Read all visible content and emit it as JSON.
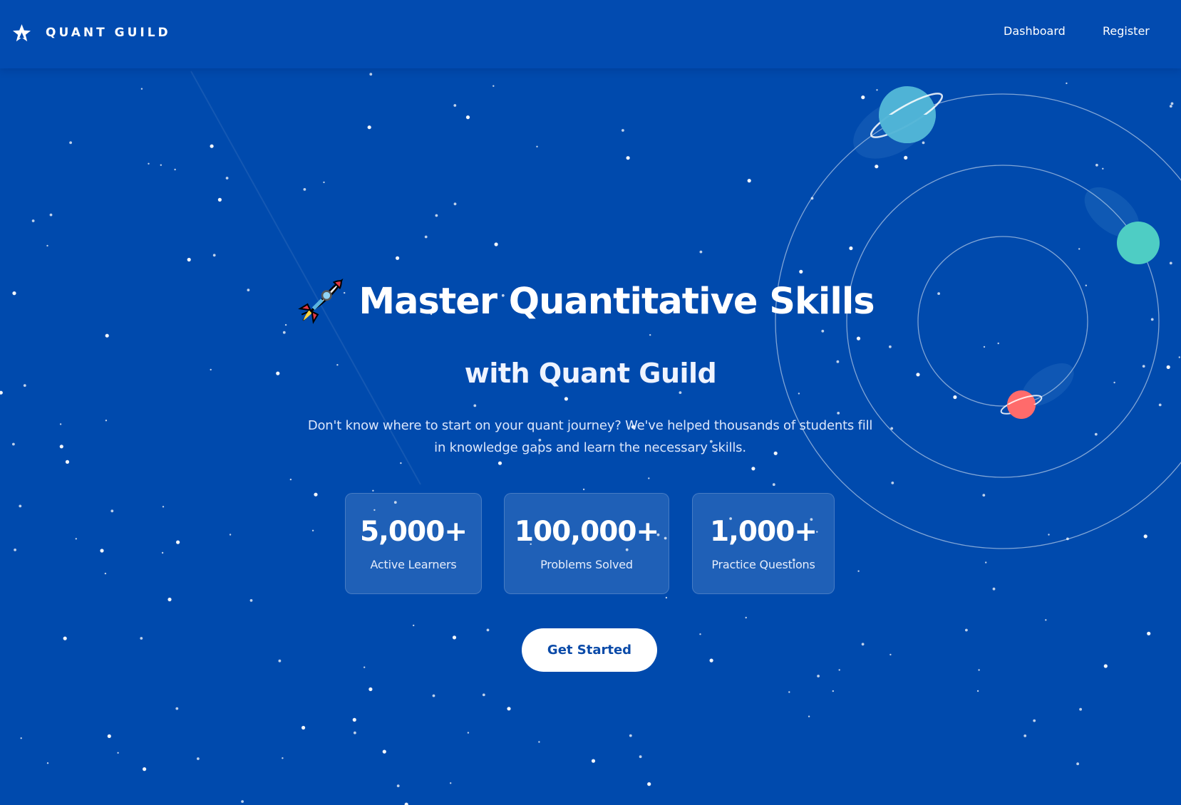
{
  "header": {
    "brand_name": "QUANT GUILD",
    "logo_icon": "star-logo-icon",
    "nav": [
      {
        "label": "Dashboard"
      },
      {
        "label": "Register"
      }
    ]
  },
  "hero": {
    "emoji_icon": "rocket-emoji-icon",
    "title": "Master Quantitative Skills",
    "subtitle": "with Quant Guild",
    "description": "Don't know where to start on your quant journey? We've helped thousands of students fill in knowledge gaps and learn the necessary skills."
  },
  "stats": [
    {
      "value": "5,000+",
      "label": "Active Learners"
    },
    {
      "value": "100,000+",
      "label": "Problems Solved"
    },
    {
      "value": "1,000+",
      "label": "Practice Questions"
    }
  ],
  "cta": {
    "label": "Get Started"
  },
  "decor": {
    "planets": [
      {
        "name": "planet-blue-icon",
        "color": "#4fb3d6"
      },
      {
        "name": "planet-teal-icon",
        "color": "#4ecdc4"
      },
      {
        "name": "planet-red-icon",
        "color": "#ff6b6b"
      }
    ],
    "background_color": "#004aad"
  }
}
